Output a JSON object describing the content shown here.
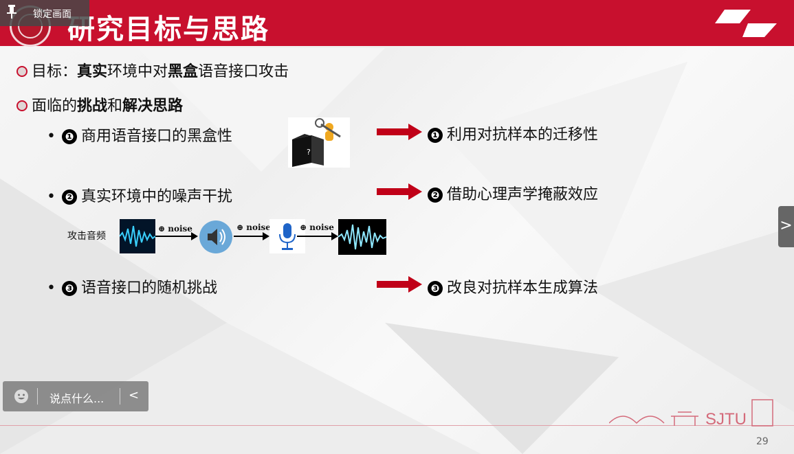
{
  "header": {
    "title": "研究目标与思路"
  },
  "lock_tooltip": {
    "label": "锁定画面"
  },
  "goal": {
    "prefix": "目标：",
    "bold1": "真实",
    "mid": "环境中对",
    "bold2": "黑盒",
    "suffix": "语音接口攻击"
  },
  "challenge": {
    "prefix": "面临的",
    "bold1": "挑战",
    "mid": "和",
    "bold2": "解决思路"
  },
  "items": [
    {
      "marker": "❶",
      "challenge": "商用语音接口的黑盒性",
      "solution": "利用对抗样本的迁移性"
    },
    {
      "marker": "❷",
      "challenge": "真实环境中的噪声干扰",
      "solution": "借助心理声学掩蔽效应"
    },
    {
      "marker": "❸",
      "challenge": "语音接口的随机挑战",
      "solution": "改良对抗样本生成算法"
    }
  ],
  "blackbox_image": {
    "question_mark": "?"
  },
  "pipeline": {
    "label": "攻击音频",
    "noise_label": "⊕ noise"
  },
  "bullet_char": "•",
  "chat": {
    "placeholder": "说点什么...",
    "collapse_icon": "<"
  },
  "next_button": {
    "icon": ">"
  },
  "footer": {
    "logo_text": "SJTU",
    "page_number": "29"
  },
  "colors": {
    "brand_red": "#c8102e",
    "arrow_red": "#c00018"
  },
  "icons": [
    "pin-icon",
    "emoji-icon",
    "chevron-left-icon",
    "chevron-right-icon",
    "speaker-icon",
    "microphone-icon",
    "waveform-icon",
    "blackbox-icon"
  ]
}
